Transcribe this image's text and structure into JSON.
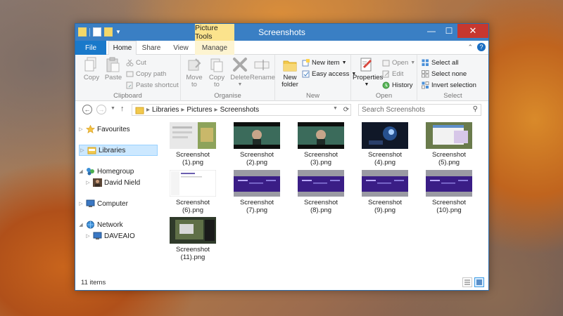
{
  "window": {
    "title": "Screenshots",
    "context_tab_group": "Picture Tools",
    "controls": {
      "minimize": "—",
      "maximize": "☐",
      "close": "✕"
    }
  },
  "tabs": [
    "File",
    "Home",
    "Share",
    "View",
    "Manage"
  ],
  "ribbon": {
    "clipboard": {
      "label": "Clipboard",
      "copy": "Copy",
      "paste": "Paste",
      "cut": "Cut",
      "copy_path": "Copy path",
      "paste_shortcut": "Paste shortcut"
    },
    "organise": {
      "label": "Organise",
      "move_to": [
        "Move",
        "to"
      ],
      "copy_to": [
        "Copy",
        "to"
      ],
      "delete": "Delete",
      "rename": "Rename"
    },
    "new": {
      "label": "New",
      "new_folder": [
        "New",
        "folder"
      ],
      "new_item": "New item",
      "easy_access": "Easy access"
    },
    "open": {
      "label": "Open",
      "properties": "Properties",
      "open": "Open",
      "edit": "Edit",
      "history": "History"
    },
    "select": {
      "label": "Select",
      "select_all": "Select all",
      "select_none": "Select none",
      "invert_selection": "Invert selection"
    }
  },
  "address": {
    "breadcrumb": [
      "Libraries",
      "Pictures",
      "Screenshots"
    ],
    "search_placeholder": "Search Screenshots"
  },
  "nav": {
    "favourites": "Favourites",
    "libraries": "Libraries",
    "homegroup": "Homegroup",
    "homegroup_user": "David Nield",
    "computer": "Computer",
    "network": "Network",
    "network_pc": "DAVEAIO"
  },
  "files": [
    {
      "name": [
        "Screenshot",
        "(1).png"
      ],
      "thumb": "desktop"
    },
    {
      "name": [
        "Screenshot",
        "(2).png"
      ],
      "thumb": "film-green"
    },
    {
      "name": [
        "Screenshot",
        "(3).png"
      ],
      "thumb": "film-green"
    },
    {
      "name": [
        "Screenshot",
        "(4).png"
      ],
      "thumb": "dark-blue"
    },
    {
      "name": [
        "Screenshot",
        "(5).png"
      ],
      "thumb": "desktop-windows"
    },
    {
      "name": [
        "Screenshot",
        "(6).png"
      ],
      "thumb": "white-page"
    },
    {
      "name": [
        "Screenshot",
        "(7).png"
      ],
      "thumb": "purple-page"
    },
    {
      "name": [
        "Screenshot",
        "(8).png"
      ],
      "thumb": "purple-page"
    },
    {
      "name": [
        "Screenshot",
        "(9).png"
      ],
      "thumb": "purple-page"
    },
    {
      "name": [
        "Screenshot",
        "(10).png"
      ],
      "thumb": "purple-page"
    },
    {
      "name": [
        "Screenshot",
        "(11).png"
      ],
      "thumb": "desktop-dark"
    }
  ],
  "status": {
    "item_count": "11 items"
  },
  "colors": {
    "titlebar": "#3a7fc4",
    "file_tab": "#1979ca",
    "context_tab": "#fbe38c",
    "close_button": "#c7372f",
    "selection": "#cce8ff"
  }
}
